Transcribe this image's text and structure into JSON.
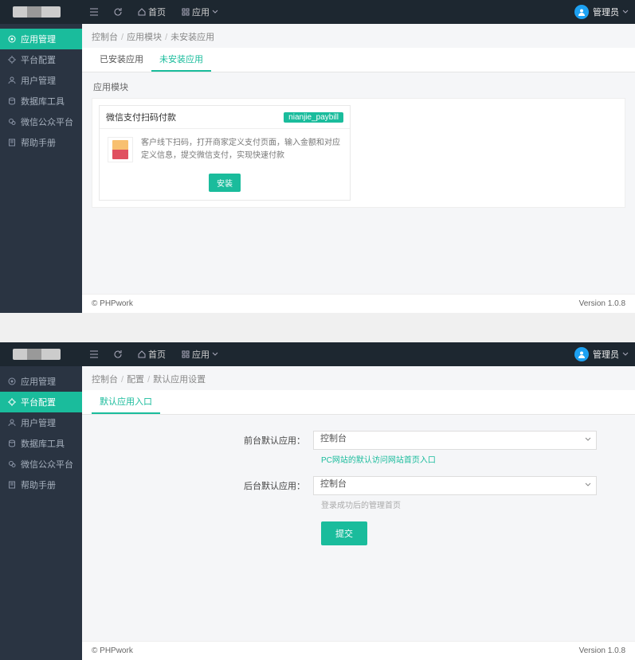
{
  "topbar": {
    "home": "首页",
    "apps": "应用",
    "user": "管理员"
  },
  "sidebar": {
    "items": [
      {
        "label": "应用管理"
      },
      {
        "label": "平台配置"
      },
      {
        "label": "用户管理"
      },
      {
        "label": "数据库工具"
      },
      {
        "label": "微信公众平台"
      },
      {
        "label": "帮助手册"
      }
    ]
  },
  "sidebar2": {
    "items": [
      {
        "label": "应用管理"
      },
      {
        "label": "平台配置"
      },
      {
        "label": "用户管理"
      },
      {
        "label": "数据库工具"
      },
      {
        "label": "微信公众平台"
      },
      {
        "label": "帮助手册"
      }
    ]
  },
  "panel1": {
    "crumb": [
      "控制台",
      "应用模块",
      "未安装应用"
    ],
    "tabs": [
      "已安装应用",
      "未安装应用"
    ],
    "section": "应用模块",
    "module": {
      "title": "微信支付扫码付款",
      "badge": "nianjie_paybill",
      "desc": "客户线下扫码，打开商家定义支付页面，输入金额和对应定义信息，提交微信支付，实现快速付款",
      "install": "安装"
    }
  },
  "panel2": {
    "crumb": [
      "控制台",
      "配置",
      "默认应用设置"
    ],
    "tabs": [
      "默认应用入口"
    ],
    "form": {
      "front_label": "前台默认应用：",
      "front_value": "控制台",
      "front_hint": "PC网站的默认访问网站首页入口",
      "back_label": "后台默认应用：",
      "back_value": "控制台",
      "back_hint": "登录成功后的管理首页",
      "submit": "提交"
    }
  },
  "footer": {
    "copyright": "© PHPwork",
    "version": "Version 1.0.8"
  }
}
